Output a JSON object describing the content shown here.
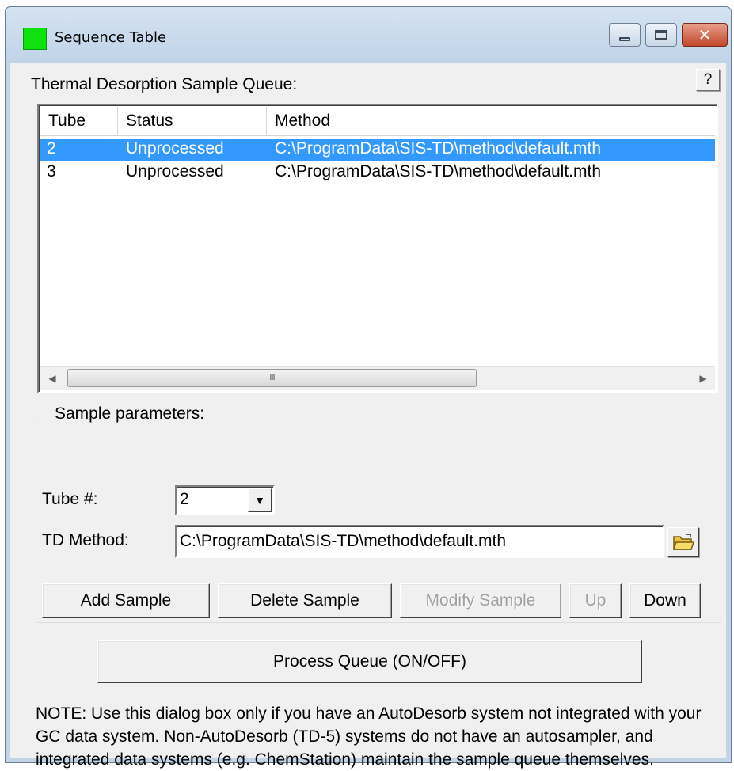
{
  "window": {
    "title": "Sequence Table",
    "controls": [
      "minimize-icon",
      "maximize-icon",
      "close-icon"
    ],
    "icon_color": "#10e010"
  },
  "help_label": "?",
  "queue": {
    "label": "Thermal Desorption Sample Queue:",
    "columns": [
      "Tube",
      "Status",
      "Method"
    ],
    "rows": [
      {
        "tube": "2",
        "status": "Unprocessed",
        "method": "C:\\ProgramData\\SIS-TD\\method\\default.mth",
        "selected": true
      },
      {
        "tube": "3",
        "status": "Unprocessed",
        "method": "C:\\ProgramData\\SIS-TD\\method\\default.mth",
        "selected": false
      }
    ],
    "scroll_grip": "III",
    "selection_color": "#3399ff"
  },
  "params": {
    "legend": "Sample parameters:",
    "tube_label": "Tube #:",
    "tube_value": "2",
    "method_label": "TD Method:",
    "method_value": "C:\\ProgramData\\SIS-TD\\method\\default.mth"
  },
  "buttons": {
    "add": "Add Sample",
    "delete": "Delete Sample",
    "modify": "Modify Sample",
    "up": "Up",
    "down": "Down",
    "process": "Process Queue (ON/OFF)"
  },
  "note": "NOTE: Use this dialog box only if you have an AutoDesorb system not integrated with your GC data system.  Non-AutoDesorb (TD-5) systems do not have an autosampler, and integrated data systems (e.g. ChemStation) maintain the sample queue themselves."
}
